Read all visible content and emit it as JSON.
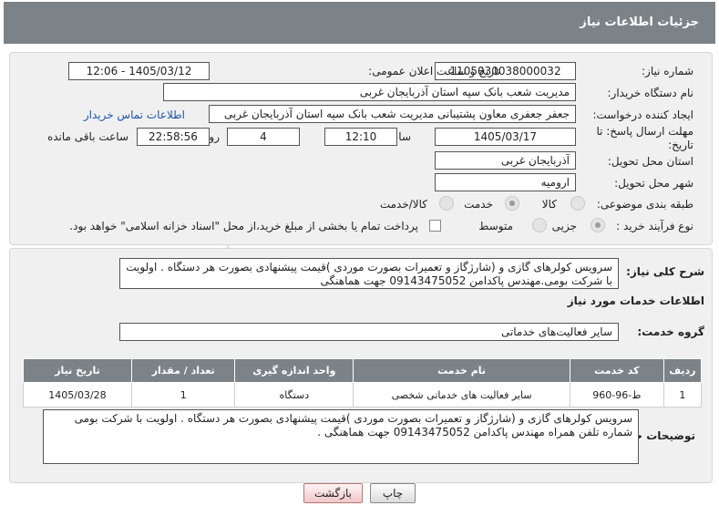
{
  "header": {
    "title": "جزئیات اطلاعات نیاز"
  },
  "form": {
    "need_number_label": "شماره نیاز:",
    "need_number": "1105030038000032",
    "announce_label": "تاریخ و ساعت اعلان عمومی:",
    "announce_value": "1405/03/12 - 12:06",
    "buyer_org_label": "نام دستگاه خریدار:",
    "buyer_org": "مدیریت شعب بانک سپه استان آذربایجان غربی",
    "creator_label": "ایجاد کننده درخواست:",
    "creator": "جعفر جعفری معاون پشتیبانی مدیریت شعب بانک سپه استان آذربایجان غربی",
    "contact_link": "اطلاعات تماس خریدار",
    "deadline_label": "مهلت ارسال پاسخ: تا تاریخ:",
    "deadline_date": "1405/03/17",
    "time_label": "ساعت",
    "deadline_time": "12:10",
    "days_value": "4",
    "days_label": "روز و",
    "remaining_time": "22:58:56",
    "remaining_label": "ساعت باقی مانده",
    "province_label": "استان محل تحویل:",
    "province": "آذربایجان غربی",
    "city_label": "شهر محل تحویل:",
    "city": "ارومیه",
    "category_label": "طبقه بندی موضوعی:",
    "category_options": [
      "کالا",
      "خدمت",
      "کالا/خدمت"
    ],
    "category_selected": "خدمت",
    "process_label": "نوع فرآیند خرید :",
    "process_options": [
      "جزیی",
      "متوسط"
    ],
    "process_selected": "جزیی",
    "payment_note": "پرداخت تمام یا بخشی از مبلغ خرید،از محل \"اسناد خزانه اسلامی\" خواهد بود."
  },
  "need": {
    "desc_label": "شرح کلی نیاز:",
    "desc": "سرویس کولرهای گازی و  (شارژگاز و تعمیرات بصورت موردی )قیمت پیشنهادی بصورت هر دستگاه . اولویت با شرکت بومی.مهندس پاکدامن 09143475052 جهت هماهنگی",
    "services_title": "اطلاعات خدمات مورد نیاز",
    "group_label": "گروه خدمت:",
    "group": "سایر فعالیت‌های خدماتی"
  },
  "table": {
    "headers": [
      "ردیف",
      "کد خدمت",
      "نام خدمت",
      "واحد اندازه گیری",
      "تعداد / مقدار",
      "تاریخ نیاز"
    ],
    "rows": [
      [
        "1",
        "ط-96-960",
        "سایر فعالیت های خدماتی شخصی",
        "دستگاه",
        "1",
        "1405/03/28"
      ]
    ]
  },
  "buyer_notes": {
    "label": "توضیحات خریدار:",
    "text": "سرویس کولرهای گازی و  (شارژگاز و تعمیرات بصورت موردی )قیمت پیشنهادی بصورت هر دستگاه . اولویت با شرکت بومی شماره تلفن همراه مهندس پاکدامن 09143475052 جهت هماهنگی ."
  },
  "buttons": {
    "print": "چاپ",
    "back": "بازگشت"
  },
  "colors": {
    "header_bg": "#7b8288",
    "link": "#1a56b0",
    "panel_bg": "#f0f0f0"
  }
}
